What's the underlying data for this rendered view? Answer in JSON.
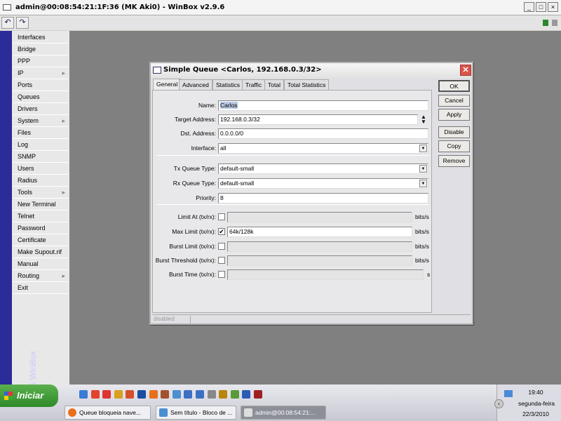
{
  "window": {
    "title": "admin@00:08:54:21:1F:36 (MK Aki0) - WinBox v2.9.6"
  },
  "toolbar": {
    "undo": "↶",
    "redo": "↷"
  },
  "sidebar": {
    "brand": "RouterOS WinBox",
    "items": [
      {
        "label": "Interfaces"
      },
      {
        "label": "Bridge"
      },
      {
        "label": "PPP"
      },
      {
        "label": "IP",
        "submenu": true
      },
      {
        "label": "Ports"
      },
      {
        "label": "Queues"
      },
      {
        "label": "Drivers"
      },
      {
        "label": "System",
        "submenu": true
      },
      {
        "label": "Files"
      },
      {
        "label": "Log"
      },
      {
        "label": "SNMP"
      },
      {
        "label": "Users"
      },
      {
        "label": "Radius"
      },
      {
        "label": "Tools",
        "submenu": true
      },
      {
        "label": "New Terminal"
      },
      {
        "label": "Telnet"
      },
      {
        "label": "Password"
      },
      {
        "label": "Certificate"
      },
      {
        "label": "Make Supout.rif"
      },
      {
        "label": "Manual"
      },
      {
        "label": "Routing",
        "submenu": true
      },
      {
        "label": "Exit"
      }
    ]
  },
  "dialog": {
    "title": "Simple Queue <Carlos, 192.168.0.3/32>",
    "tabs": [
      "General",
      "Advanced",
      "Statistics",
      "Traffic",
      "Total",
      "Total Statistics"
    ],
    "fields": {
      "name": {
        "label": "Name:",
        "value": "Carlos"
      },
      "target": {
        "label": "Target Address:",
        "value": "192.168.0.3/32"
      },
      "dst": {
        "label": "Dst. Address:",
        "value": "0.0.0.0/0"
      },
      "iface": {
        "label": "Interface:",
        "value": "all"
      },
      "tx": {
        "label": "Tx Queue Type:",
        "value": "default-small"
      },
      "rx": {
        "label": "Rx Queue Type:",
        "value": "default-small"
      },
      "priority": {
        "label": "Priority:",
        "value": "8"
      },
      "limit_at": {
        "label": "Limit At (tx/rx):",
        "checked": false,
        "value": "",
        "unit": "bits/s"
      },
      "max_limit": {
        "label": "Max Limit (tx/rx):",
        "checked": true,
        "value": "64k/128k",
        "unit": "bits/s"
      },
      "burst_limit": {
        "label": "Burst Limit (tx/rx):",
        "checked": false,
        "value": "",
        "unit": "bits/s"
      },
      "burst_threshold": {
        "label": "Burst Threshold (tx/rx):",
        "checked": false,
        "value": "",
        "unit": "bits/s"
      },
      "burst_time": {
        "label": "Burst Time (tx/rx):",
        "checked": false,
        "value": "",
        "unit": "s"
      }
    },
    "buttons": {
      "ok": "OK",
      "cancel": "Cancel",
      "apply": "Apply",
      "disable": "Disable",
      "copy": "Copy",
      "remove": "Remove"
    },
    "status": "disabled"
  },
  "taskbar": {
    "start": "Iniciar",
    "tasks": [
      "Queue bloqueia nave...",
      "Sem título - Bloco de ...",
      "admin@00:08:54:21:..."
    ],
    "time": "19:40",
    "day": "segunda-feira",
    "date": "22/3/2010"
  }
}
